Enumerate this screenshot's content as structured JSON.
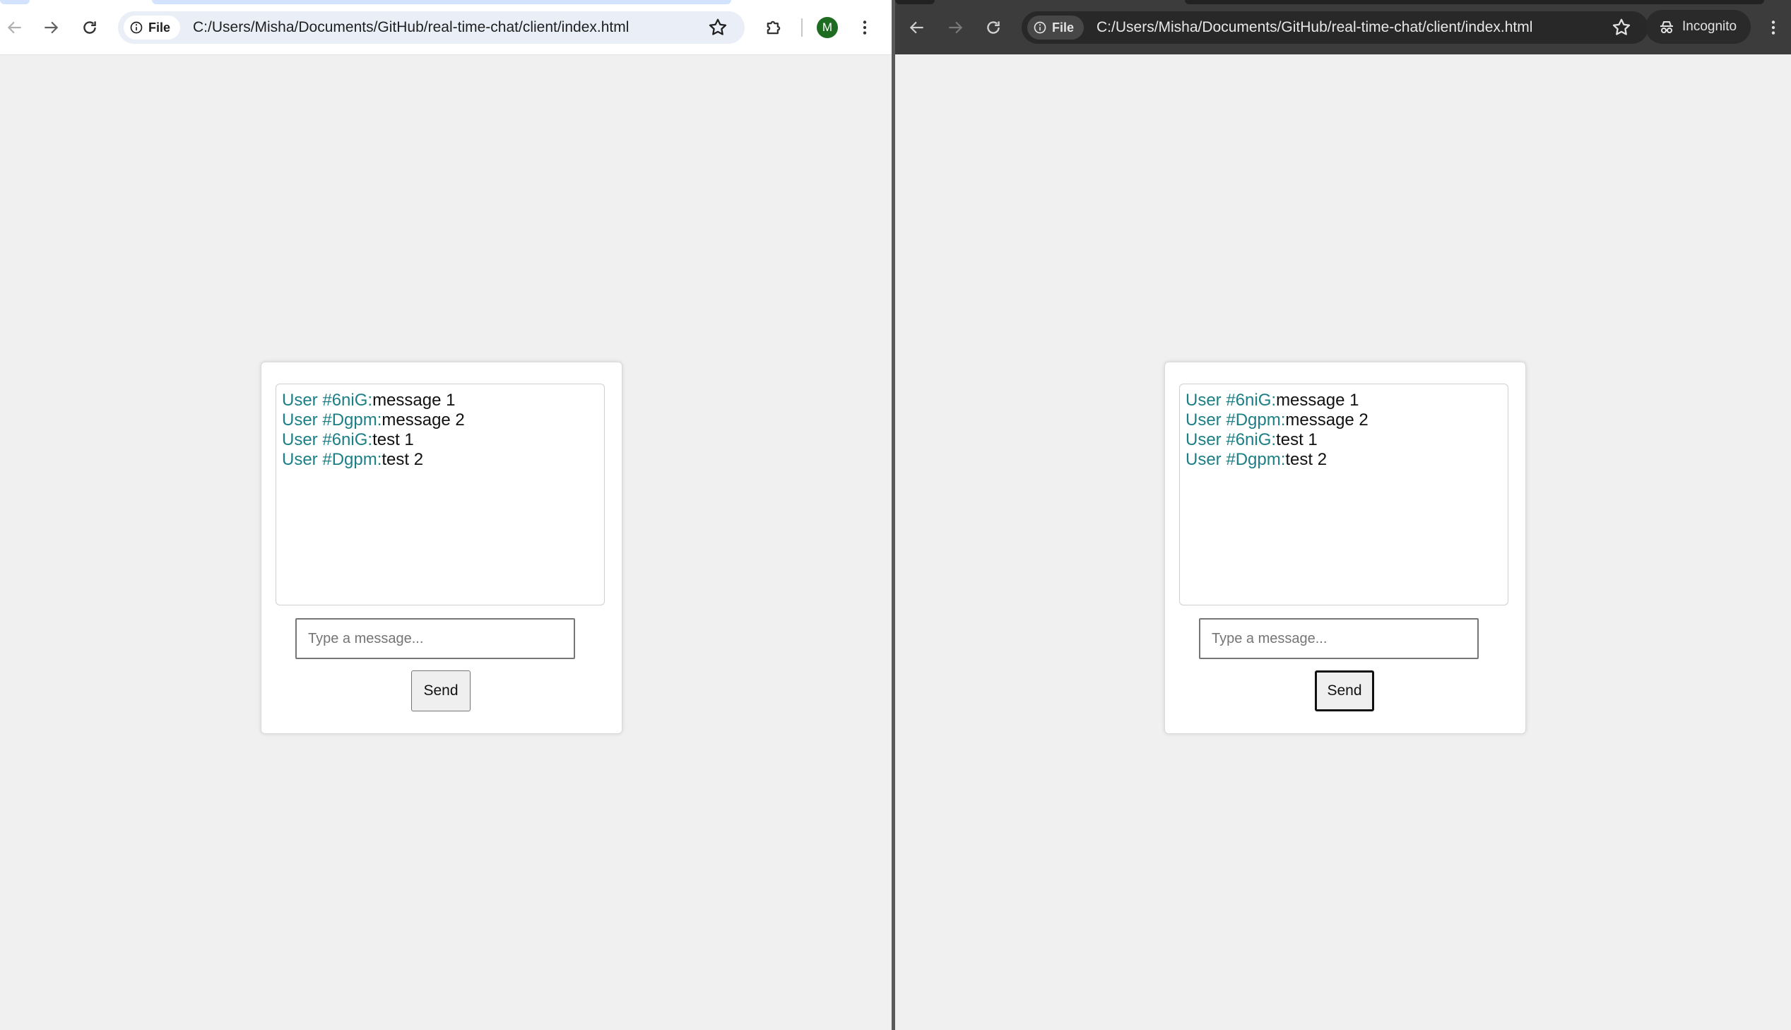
{
  "left_window": {
    "file_chip": "File",
    "url": "C:/Users/Misha/Documents/GitHub/real-time-chat/client/index.html",
    "profile_initial": "M",
    "chat": {
      "messages": [
        {
          "user": "User #6niG:",
          "text": "message 1"
        },
        {
          "user": "User #Dgpm:",
          "text": "message 2"
        },
        {
          "user": "User #6niG:",
          "text": "test 1"
        },
        {
          "user": "User #Dgpm:",
          "text": "test 2"
        }
      ],
      "input_placeholder": "Type a message...",
      "send_label": "Send"
    }
  },
  "right_window": {
    "file_chip": "File",
    "url": "C:/Users/Misha/Documents/GitHub/real-time-chat/client/index.html",
    "incognito_label": "Incognito",
    "chat": {
      "messages": [
        {
          "user": "User #6niG:",
          "text": "message 1"
        },
        {
          "user": "User #Dgpm:",
          "text": "message 2"
        },
        {
          "user": "User #6niG:",
          "text": "test 1"
        },
        {
          "user": "User #Dgpm:",
          "text": "test 2"
        }
      ],
      "input_placeholder": "Type a message...",
      "send_label": "Send"
    }
  },
  "colors": {
    "username": "#1c7f86",
    "page_background": "#f0f0f0",
    "incognito_toolbar": "#3c3c3c",
    "profile_avatar": "#1e6b22"
  },
  "icons": [
    "back-arrow-icon",
    "forward-arrow-icon",
    "reload-icon",
    "info-icon",
    "star-icon",
    "extensions-icon",
    "menu-dots-icon",
    "incognito-icon"
  ]
}
